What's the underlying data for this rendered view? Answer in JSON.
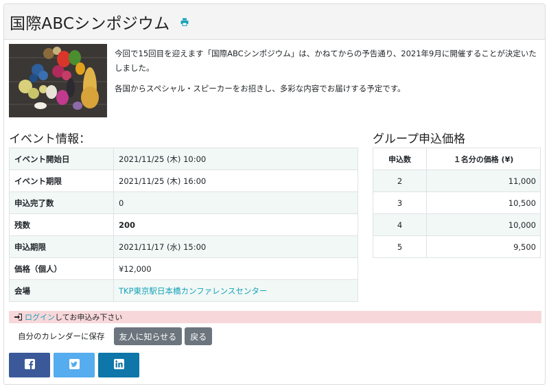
{
  "event": {
    "title": "国際ABCシンポジウム",
    "intro": [
      "今回で15回目を迎えます「国際ABCシンポジウム」は、かねてからの予告通り、2021年9月に開催することが決定いたしました。",
      "各国からスペシャル・スピーカーをお招きし、多彩な内容でお届けする予定です。"
    ]
  },
  "info": {
    "heading": "イベント情報：",
    "rows": [
      {
        "label": "イベント開始日",
        "value": "2021/11/25 (木) 10:00"
      },
      {
        "label": "イベント期限",
        "value": "2021/11/25 (木) 16:00"
      },
      {
        "label": "申込完了数",
        "value": "0"
      },
      {
        "label": "残数",
        "value": "200"
      },
      {
        "label": "申込期限",
        "value": "2021/11/17 (水) 15:00"
      },
      {
        "label": "価格（個人）",
        "value": "¥12,000"
      },
      {
        "label": "会場",
        "value": "TKP東京駅日本橋カンファレンスセンター"
      }
    ]
  },
  "group_pricing": {
    "heading": "グループ申込価格",
    "columns": [
      "申込数",
      "１名分の価格 (¥)"
    ],
    "rows": [
      {
        "count": "2",
        "price": "11,000"
      },
      {
        "count": "3",
        "price": "10,500"
      },
      {
        "count": "4",
        "price": "10,000"
      },
      {
        "count": "5",
        "price": "9,500"
      }
    ]
  },
  "login": {
    "link_text": "ログイン",
    "suffix": "してお申込み下さい"
  },
  "actions": {
    "calendar_label": "自分のカレンダーに保存",
    "tell_friend": "友人に知らせる",
    "back": "戻る"
  },
  "colors": {
    "accent": "#17a2b8",
    "facebook": "#3b5998",
    "twitter": "#55acee",
    "linkedin": "#0e76a8",
    "alert": "#f8d7da",
    "stripe": "#f1f8f6",
    "secondary": "#6c757d"
  },
  "icons": [
    "print-icon",
    "login-icon",
    "facebook-icon",
    "twitter-icon",
    "linkedin-icon"
  ]
}
